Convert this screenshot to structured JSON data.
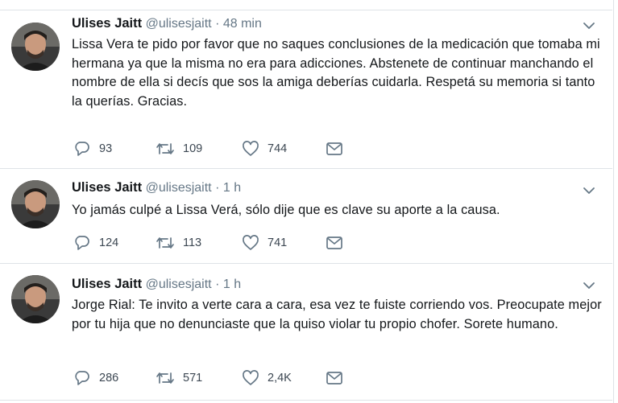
{
  "tweets": [
    {
      "name": "Ulises Jaitt",
      "handle": "@ulisesjaitt",
      "separator": "·",
      "time": "48 min",
      "text": "Lissa Vera te pido por favor que no saques conclusiones de la medicación que tomaba mi hermana ya que la misma no era para adicciones. Abstenete de continuar manchando el nombre de ella si decís que sos la amiga deberías cuidarla. Respetá su memoria si tanto la querías. Gracias.",
      "replies": "93",
      "retweets": "109",
      "likes": "744"
    },
    {
      "name": "Ulises Jaitt",
      "handle": "@ulisesjaitt",
      "separator": "·",
      "time": "1 h",
      "text": "Yo jamás culpé a Lissa Verá, sólo dije que es clave su aporte a la causa.",
      "replies": "124",
      "retweets": "113",
      "likes": "741"
    },
    {
      "name": "Ulises Jaitt",
      "handle": "@ulisesjaitt",
      "separator": "·",
      "time": "1 h",
      "text": "Jorge Rial: Te invito a verte cara a cara, esa vez te fuiste corriendo vos. Preocupate mejor por tu hija que no denunciaste que la quiso violar tu propio chofer. Sorete humano.",
      "replies": "286",
      "retweets": "571",
      "likes": "2,4K"
    }
  ],
  "icons": {
    "reply": "reply-icon",
    "retweet": "retweet-icon",
    "like": "heart-icon",
    "message": "direct-message-icon",
    "menu": "chevron-down-icon"
  },
  "colors": {
    "text": "#14171a",
    "secondary": "#657786",
    "icon": "#657786",
    "border": "#dfe3e7"
  }
}
